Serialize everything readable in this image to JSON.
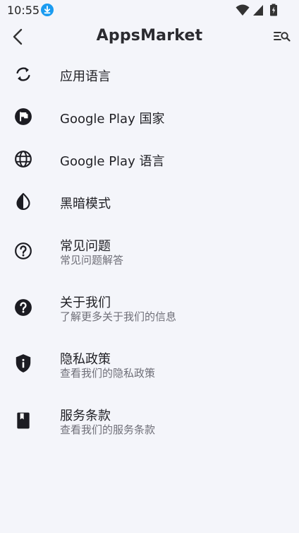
{
  "status_bar": {
    "time": "10:55"
  },
  "app_bar": {
    "title": "AppsMarket"
  },
  "settings": [
    {
      "title": "应用语言",
      "subtitle": "",
      "icon": "refresh-icon"
    },
    {
      "title": "Google Play 国家",
      "subtitle": "",
      "icon": "flag-icon"
    },
    {
      "title": "Google Play 语言",
      "subtitle": "",
      "icon": "globe-icon"
    },
    {
      "title": "黑暗模式",
      "subtitle": "",
      "icon": "contrast-icon"
    },
    {
      "title": "常见问题",
      "subtitle": "常见问题解答",
      "icon": "help-outline-icon"
    },
    {
      "title": "关于我们",
      "subtitle": "了解更多关于我们的信息",
      "icon": "help-filled-icon"
    },
    {
      "title": "隐私政策",
      "subtitle": "查看我们的隐私政策",
      "icon": "shield-info-icon"
    },
    {
      "title": "服务条款",
      "subtitle": "查看我们的服务条款",
      "icon": "book-icon"
    }
  ],
  "colors": {
    "background": "#f4f5fa",
    "download_badge": "#1a9bf0",
    "icon": "#1c1c22",
    "subtitle": "#6f6f78"
  }
}
